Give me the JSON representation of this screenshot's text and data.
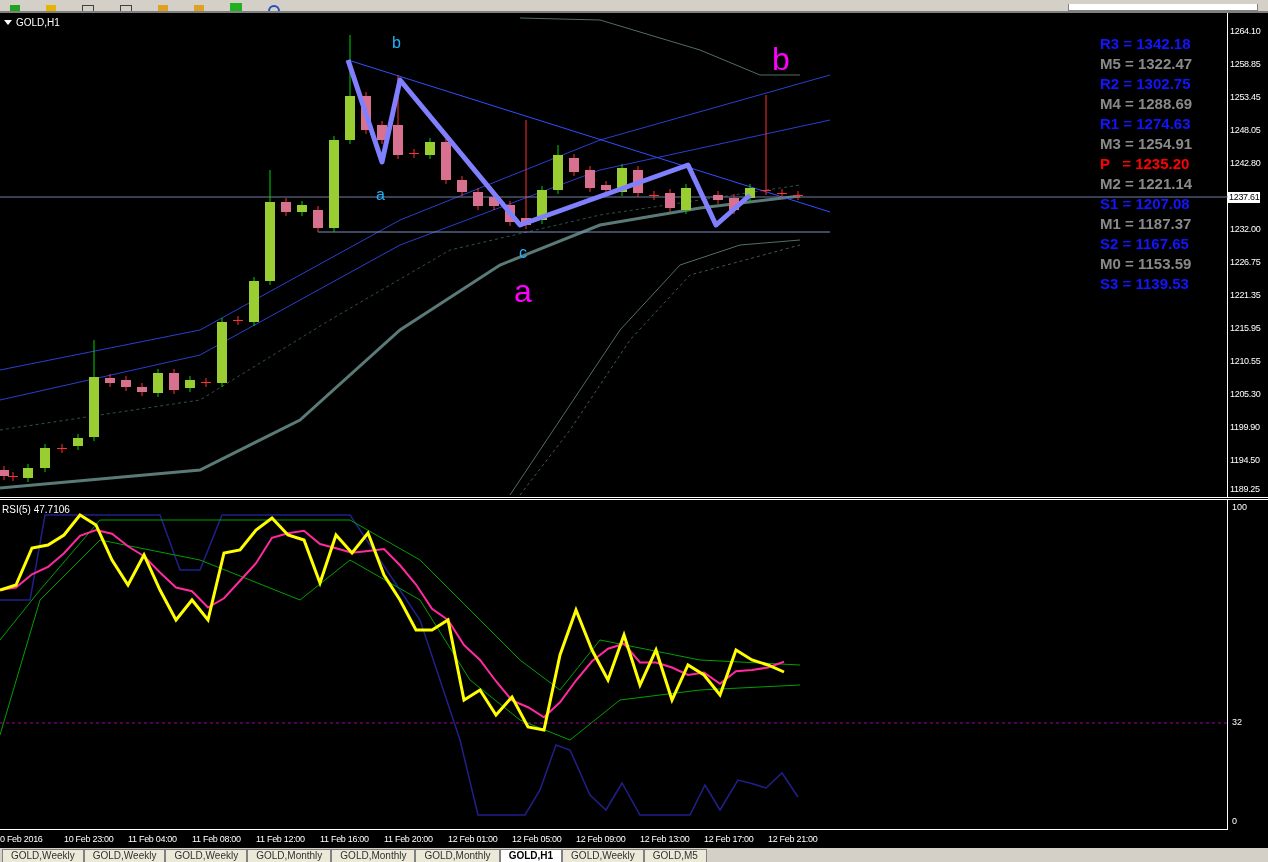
{
  "chart": {
    "symbol": "GOLD,H1",
    "price_axis": [
      "1264.10",
      "1258.85",
      "1253.45",
      "1248.05",
      "1242.80",
      "1232.00",
      "1226.75",
      "1221.35",
      "1215.95",
      "1210.55",
      "1205.30",
      "1199.90",
      "1194.50",
      "1189.25"
    ],
    "current_price": "1237.61",
    "pivots": [
      {
        "text": "R3 = 1342.18",
        "kind": "level"
      },
      {
        "text": "M5 = 1322.47",
        "kind": "mid"
      },
      {
        "text": "R2 = 1302.75",
        "kind": "level"
      },
      {
        "text": "M4 = 1288.69",
        "kind": "mid"
      },
      {
        "text": "R1 = 1274.63",
        "kind": "level"
      },
      {
        "text": "M3 = 1254.91",
        "kind": "mid"
      },
      {
        "text": "P   = 1235.20",
        "kind": "pivot"
      },
      {
        "text": "M2 = 1221.14",
        "kind": "mid"
      },
      {
        "text": "S1 = 1207.08",
        "kind": "level"
      },
      {
        "text": "M1 = 1187.37",
        "kind": "mid"
      },
      {
        "text": "S2 = 1167.65",
        "kind": "level"
      },
      {
        "text": "M0 = 1153.59",
        "kind": "mid"
      },
      {
        "text": "S3 = 1139.53",
        "kind": "level"
      }
    ],
    "wave_labels": [
      {
        "text": "b",
        "kind": "minor"
      },
      {
        "text": "a",
        "kind": "minor"
      },
      {
        "text": "c",
        "kind": "minor"
      },
      {
        "text": "a",
        "kind": "major"
      },
      {
        "text": "b",
        "kind": "major"
      }
    ]
  },
  "indicator": {
    "title": "RSI(5) 47.7106",
    "axis": [
      "100",
      "32",
      "0"
    ]
  },
  "time_axis": [
    "0 Feb 2016",
    "10 Feb 23:00",
    "11 Feb 04:00",
    "11 Feb 08:00",
    "11 Feb 12:00",
    "11 Feb 16:00",
    "11 Feb 20:00",
    "12 Feb 01:00",
    "12 Feb 05:00",
    "12 Feb 09:00",
    "12 Feb 13:00",
    "12 Feb 17:00",
    "12 Feb 21:00"
  ],
  "tabs": [
    {
      "label": "GOLD,Weekly",
      "selected": false
    },
    {
      "label": "GOLD,Weekly",
      "selected": false
    },
    {
      "label": "GOLD,Weekly",
      "selected": false
    },
    {
      "label": "GOLD,Monthly",
      "selected": false
    },
    {
      "label": "GOLD,Monthly",
      "selected": false
    },
    {
      "label": "GOLD,Monthly",
      "selected": false
    },
    {
      "label": "GOLD,H1",
      "selected": true
    },
    {
      "label": "GOLD,Weekly",
      "selected": false
    },
    {
      "label": "GOLD,M5",
      "selected": false
    }
  ]
}
